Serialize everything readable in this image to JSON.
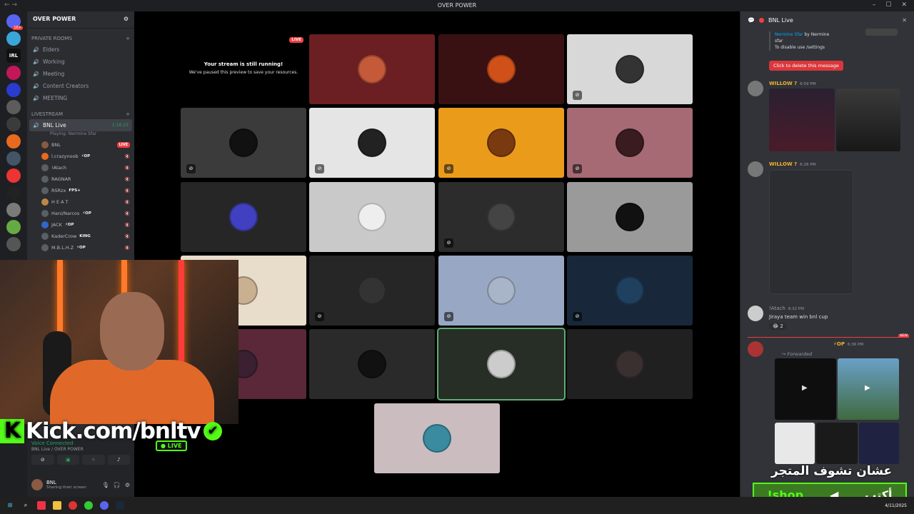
{
  "window": {
    "title": "OVER POWER",
    "nav_back": "←",
    "nav_fwd": "→"
  },
  "server_badges": {
    "first": "1K+",
    "irl": "IRL"
  },
  "sidebar": {
    "server_name": "OVER POWER",
    "private_rooms_label": "PRIVATE ROOMS",
    "rooms": [
      {
        "label": "Elders"
      },
      {
        "label": "Working"
      },
      {
        "label": "Meeting"
      },
      {
        "label": "Content Creators"
      },
      {
        "label": "MEETING"
      }
    ],
    "livestream_label": "LIVESTREAM",
    "active_channel": {
      "label": "BNL Live",
      "time": "1:16:23",
      "playing": "Playing: Nermine Sfar"
    },
    "members": [
      {
        "name": "BNL",
        "badge": "LIVE"
      },
      {
        "name": "l.crazynoob",
        "tag": "⚡OP"
      },
      {
        "name": "!Atach",
        "tag": ""
      },
      {
        "name": "RAGNAR",
        "tag": ""
      },
      {
        "name": "RSRzx",
        "tag": "FPS+"
      },
      {
        "name": "H E A T",
        "tag": ""
      },
      {
        "name": "Hani/Narcos",
        "tag": "⚡OP"
      },
      {
        "name": "JACK",
        "tag": "⚡OP"
      },
      {
        "name": "KaderCrow",
        "tag": "KING"
      },
      {
        "name": "M.B.L.H.Z",
        "tag": "⚡OP"
      }
    ],
    "voice": {
      "status": "Voice Connected",
      "location": "BNL Live / OVER POWER"
    },
    "user": {
      "name": "BNL",
      "status": "Sharing their screen"
    }
  },
  "stage": {
    "stream_title": "Your stream is still running!",
    "stream_sub": "We've paused this preview to save your resources.",
    "live_badge": "LIVE"
  },
  "overlay": {
    "brand": "Kick.com/bnltv",
    "live": "LIVE",
    "shop_cmd": "!shop",
    "shop_write": "أكتب",
    "shop_hint": "عشان تشوف المتجر"
  },
  "chat": {
    "title": "BNL Live",
    "sys_lines": [
      "by Nermine",
      "sfar",
      "To disable use /settings"
    ],
    "sys_link": "Nermine Sfar",
    "delete_btn": "Click to delete this message",
    "messages": [
      {
        "author": "WILLOW ?",
        "time": "6:59 PM"
      },
      {
        "author": "WILLOW ?",
        "time": "6:28 PM"
      },
      {
        "author": "!Atach",
        "time": "6:32 PM",
        "text": "Jiraya team win bnl cup",
        "reaction": "😂 2"
      },
      {
        "author": "⚡OP",
        "time": "6:36 PM",
        "forward": "Forwarded"
      }
    ],
    "new_label": "NEW"
  },
  "taskbar": {
    "date": "4/11/2025"
  },
  "colors": {
    "accent": "#53fc18",
    "live": "#f23f43",
    "stage_bg": "#000000"
  },
  "icons": {
    "settings": "gear-icon",
    "close": "close-icon",
    "mic": "mic-icon",
    "headset": "headset-icon"
  }
}
